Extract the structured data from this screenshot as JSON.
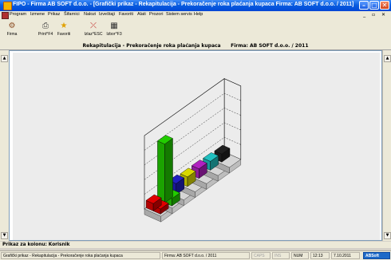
{
  "window": {
    "title": "FIPO - Firma AB SOFT d.o.o. - [Grafički prikaz - Rekapitulacija - Prekoračenje roka plaćanja kupaca      Firma: AB SOFT d.o.o. / 2011]",
    "minimize_glyph": "–",
    "maximize_glyph": "□",
    "close_glyph": "✕"
  },
  "menu": {
    "items": [
      "Program",
      "Izmene",
      "Prikaz",
      "Šifarnici",
      "Nalozi",
      "Izveštaji",
      "Favoriti",
      "Alati",
      "Prozori",
      "Sistem servis",
      "Help"
    ],
    "mdi_controls": "_ ▫ ✕"
  },
  "toolbar": {
    "buttons": [
      {
        "label": "Firma",
        "icon": "gear-icon",
        "glyph": "⚙",
        "color": "#8a4a20"
      },
      {
        "label": "Print^F4",
        "icon": "printer-icon",
        "glyph": "⎙",
        "color": "#404040"
      },
      {
        "label": "Favoriti",
        "icon": "star-icon",
        "glyph": "★",
        "color": "#e0a000"
      },
      {
        "label": "Izlaz^ESC",
        "icon": "exit-icon",
        "glyph": "⤫",
        "color": "#c02020"
      },
      {
        "label": "Izbor^F3",
        "icon": "grid-icon",
        "glyph": "▦",
        "color": "#303030"
      }
    ]
  },
  "caption": "Rekapitulacija - Prekoračenje roka plaćanja kupaca      Firma: AB SOFT d.o.o. / 2011",
  "scroll": {
    "up": "▲",
    "down": "▼"
  },
  "chart_data": {
    "type": "bar",
    "series": [
      {
        "color": "#e00000",
        "values": [
          1,
          0.7
        ]
      },
      {
        "color": "#22cc00",
        "values": [
          8,
          1
        ]
      },
      {
        "color": "#2020c0",
        "values": [
          1.5
        ]
      },
      {
        "color": "#d8d800",
        "values": [
          1.3
        ]
      },
      {
        "color": "#b020c0",
        "values": [
          1.3
        ]
      },
      {
        "color": "#20c0c0",
        "values": [
          1.2
        ]
      },
      {
        "color": "#202020",
        "values": [
          1.1
        ]
      }
    ],
    "ylim": [
      0,
      10
    ],
    "grid": true,
    "legend": "none"
  },
  "footer_label": "Prikaz za kolonu: Korisnik",
  "status": {
    "description": "Grafički prikaz - Rekapitulacija - Prekoračenje roka plaćanja kupaca",
    "firm": "Firma: AB SOFT d.o.o. / 2011",
    "caps": "CAPS",
    "ins": "INS",
    "num": "NUM",
    "time": "12:13",
    "date": "7.10.2011",
    "brand": "ABSoft"
  }
}
